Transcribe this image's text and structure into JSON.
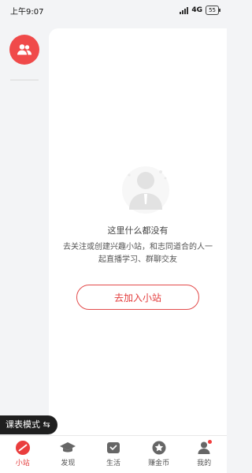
{
  "status": {
    "time": "上午9:07",
    "network": "4G",
    "battery": "55"
  },
  "empty": {
    "title": "这里什么都没有",
    "desc_line1": "去关注或创建兴趣小站，和志同道合的人一",
    "desc_line2": "起直播学习、群聊交友",
    "button": "去加入小站"
  },
  "mode_toggle": "课表模式 ⇆",
  "tabs": [
    {
      "label": "小站",
      "icon": "station-icon"
    },
    {
      "label": "发现",
      "icon": "grad-cap-icon"
    },
    {
      "label": "生活",
      "icon": "life-icon"
    },
    {
      "label": "赚金币",
      "icon": "coin-star-icon"
    },
    {
      "label": "我的",
      "icon": "profile-icon"
    }
  ],
  "colors": {
    "accent": "#e33b3b",
    "background": "#f3f4f6",
    "panel": "#ffffff"
  }
}
